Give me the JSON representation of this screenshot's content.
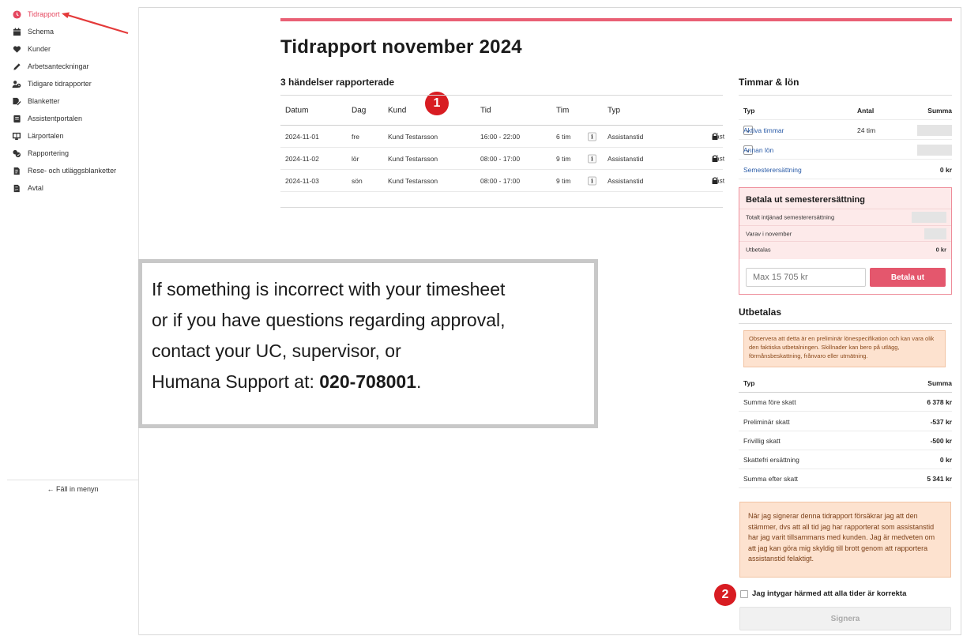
{
  "sidebar": {
    "items": [
      {
        "label": "Tidrapport",
        "icon": "clock-icon",
        "active": true
      },
      {
        "label": "Schema",
        "icon": "calendar-icon"
      },
      {
        "label": "Kunder",
        "icon": "heart-icon"
      },
      {
        "label": "Arbetsanteckningar",
        "icon": "pen-icon"
      },
      {
        "label": "Tidigare tidrapporter",
        "icon": "users-clock-icon"
      },
      {
        "label": "Blanketter",
        "icon": "form-edit-icon"
      },
      {
        "label": "Assistentportalen",
        "icon": "book-icon"
      },
      {
        "label": "Lärportalen",
        "icon": "learning-icon"
      },
      {
        "label": "Rapportering",
        "icon": "report-icon"
      },
      {
        "label": "Rese- och utläggsblanketter",
        "icon": "receipt-icon"
      },
      {
        "label": "Avtal",
        "icon": "contract-icon"
      }
    ],
    "collapse_label": "← Fäll in menyn"
  },
  "main": {
    "title": "Tidrapport november 2024",
    "events_title": "3 händelser rapporterade",
    "columns": [
      "Datum",
      "Dag",
      "Kund",
      "Tid",
      "Tim",
      "Typ"
    ],
    "rows": [
      {
        "date": "2024-11-01",
        "day": "fre",
        "kund": "Kund Testarsson",
        "tid": "16:00 - 22:00",
        "tim": "6 tim",
        "info": "i",
        "typ": "Assistanstid",
        "status": "Låst"
      },
      {
        "date": "2024-11-02",
        "day": "lör",
        "kund": "Kund Testarsson",
        "tid": "08:00 - 17:00",
        "tim": "9 tim",
        "info": "i",
        "typ": "Assistanstid",
        "status": "Låst"
      },
      {
        "date": "2024-11-03",
        "day": "sön",
        "kund": "Kund Testarsson",
        "tid": "08:00 - 17:00",
        "tim": "9 tim",
        "info": "i",
        "typ": "Assistanstid",
        "status": "Låst"
      }
    ]
  },
  "annotations": {
    "badge1": "1",
    "badge2": "2"
  },
  "note": {
    "line1": "If something is incorrect with your timesheet",
    "line2": "or if you have questions regarding approval,",
    "line3": "contact your UC, supervisor, or",
    "line4": "Humana Support at: ",
    "phone": "020-708001",
    "end": "."
  },
  "hours": {
    "title": "Timmar & lön",
    "head": {
      "typ": "Typ",
      "antal": "Antal",
      "summa": "Summa"
    },
    "active_label": "Aktiva timmar",
    "active_count": "24 tim",
    "other_label": "Annan lön",
    "vacation_label": "Semesterersättning",
    "vacation_value": "0 kr"
  },
  "payout": {
    "title": "Betala ut semesterersättning",
    "row1": "Totalt intjänad semesterersättning",
    "row2": "Varav i november",
    "row3": "Utbetalas",
    "row3_value": "0 kr",
    "input_placeholder": "Max 15 705 kr",
    "button": "Betala ut"
  },
  "utbetalas": {
    "title": "Utbetalas",
    "warning": "Observera att detta är en preliminär lönespecifikation och kan vara olik den faktiska utbetalningen. Skillnader kan bero på utlägg, förmånsbeskattning, frånvaro eller utmätning.",
    "head": {
      "typ": "Typ",
      "summa": "Summa"
    },
    "rows": [
      {
        "label": "Summa före skatt",
        "value": "6 378 kr"
      },
      {
        "label": "Preliminär skatt",
        "value": "-537 kr"
      },
      {
        "label": "Frivillig skatt",
        "value": "-500 kr"
      },
      {
        "label": "Skattefri ersättning",
        "value": "0 kr"
      },
      {
        "label": "Summa efter skatt",
        "value": "5 341 kr"
      }
    ]
  },
  "legal": "När jag signerar denna tidrapport försäkrar jag att den stämmer, dvs att all tid jag har rapporterat som assistanstid har jag varit tillsammans med kunden. Jag är medveten om att jag kan göra mig skyldig till brott genom att rapportera assistanstid felaktigt.",
  "certify_label": "Jag intygar härmed att alla tider är korrekta",
  "sign_button": "Signera",
  "colors": {
    "accent": "#e5475f",
    "badge": "#d81c22",
    "warning_bg": "#fde2cf"
  }
}
